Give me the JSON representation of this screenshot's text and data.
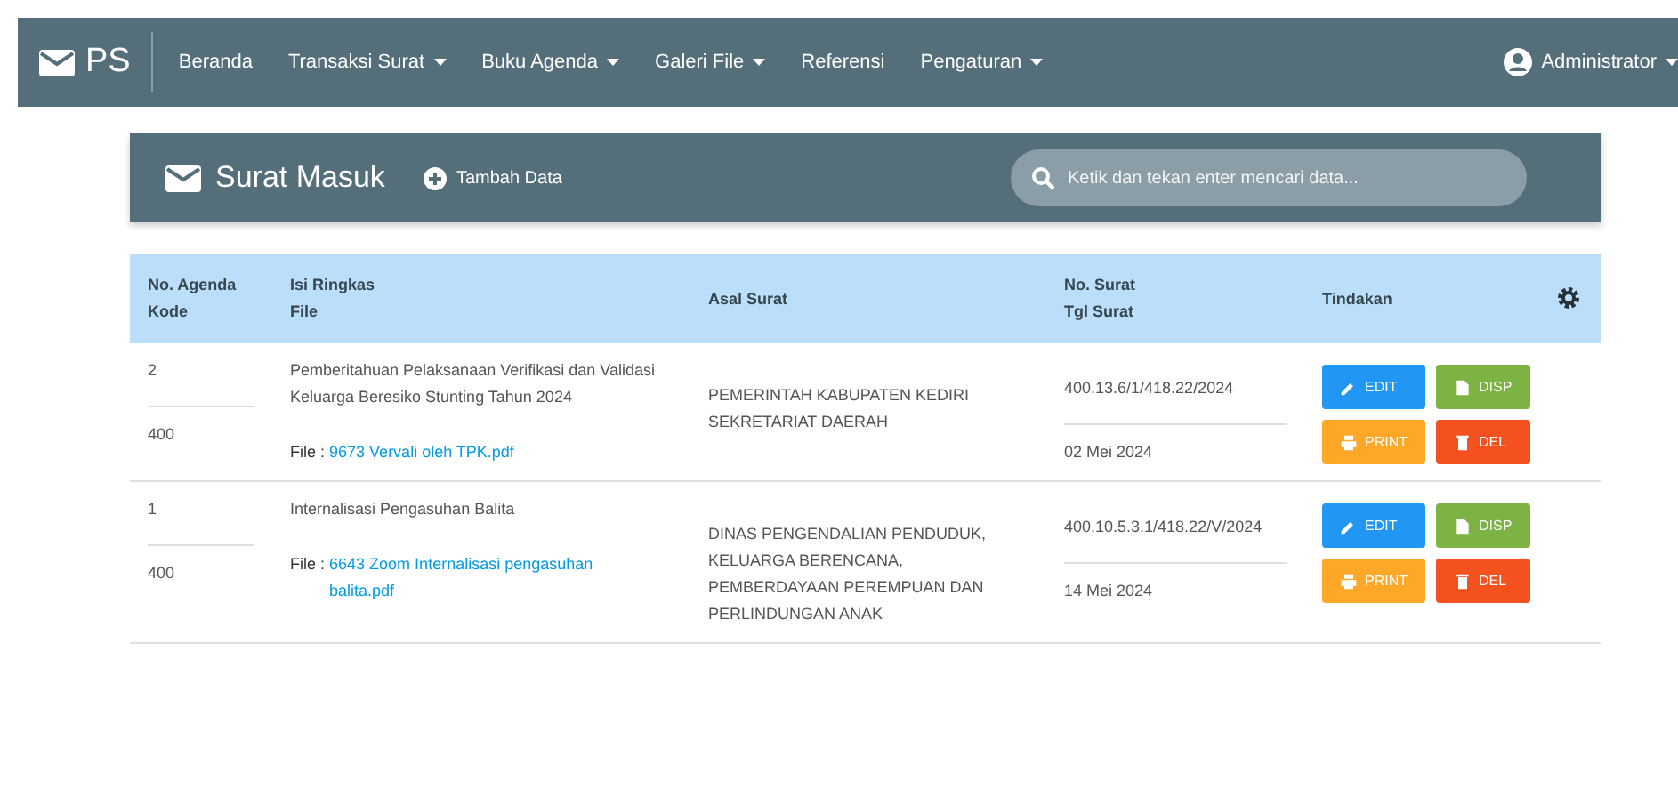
{
  "navbar": {
    "brand": "PS",
    "menu": [
      {
        "label": "Beranda",
        "dropdown": false
      },
      {
        "label": "Transaksi Surat",
        "dropdown": true
      },
      {
        "label": "Buku Agenda",
        "dropdown": true
      },
      {
        "label": "Galeri File",
        "dropdown": true
      },
      {
        "label": "Referensi",
        "dropdown": false
      },
      {
        "label": "Pengaturan",
        "dropdown": true
      }
    ],
    "user": {
      "label": "Administrator",
      "dropdown": true
    }
  },
  "header": {
    "title": "Surat Masuk",
    "add_button": "Tambah Data",
    "search": {
      "placeholder": "Ketik dan tekan enter mencari data..."
    }
  },
  "table": {
    "columns": [
      {
        "lines": [
          "No. Agenda",
          "Kode"
        ]
      },
      {
        "lines": [
          "Isi Ringkas",
          "File"
        ]
      },
      {
        "lines": [
          "Asal Surat"
        ]
      },
      {
        "lines": [
          "No. Surat",
          "Tgl Surat"
        ]
      },
      {
        "lines": [
          "Tindakan"
        ]
      }
    ],
    "rows": [
      {
        "agenda": "2",
        "kode": "400",
        "isi": "Pemberitahuan Pelaksanaan Verifikasi dan Validasi Keluarga Beresiko Stunting Tahun 2024",
        "file_label": "File :",
        "file": "9673 Vervali oleh TPK.pdf",
        "asal": "PEMERINTAH KABUPATEN KEDIRI SEKRETARIAT DAERAH",
        "no_surat": "400.13.6/1/418.22/2024",
        "tgl": "02 Mei 2024",
        "actions": [
          {
            "kind": "edit",
            "label": "EDIT"
          },
          {
            "kind": "disp",
            "label": "DISP"
          },
          {
            "kind": "print",
            "label": "PRINT"
          },
          {
            "kind": "del",
            "label": "DEL"
          }
        ]
      },
      {
        "agenda": "1",
        "kode": "400",
        "isi": "Internalisasi Pengasuhan Balita",
        "file_label": "File :",
        "file": "6643 Zoom Internalisasi pengasuhan balita.pdf",
        "asal": "DINAS PENGENDALIAN PENDUDUK, KELUARGA BERENCANA, PEMBERDAYAAN PEREMPUAN DAN PERLINDUNGAN ANAK",
        "no_surat": "400.10.5.3.1/418.22/V/2024",
        "tgl": "14 Mei 2024",
        "actions": [
          {
            "kind": "edit",
            "label": "EDIT"
          },
          {
            "kind": "disp",
            "label": "DISP"
          },
          {
            "kind": "print",
            "label": "PRINT"
          },
          {
            "kind": "del",
            "label": "DEL"
          }
        ]
      }
    ]
  }
}
